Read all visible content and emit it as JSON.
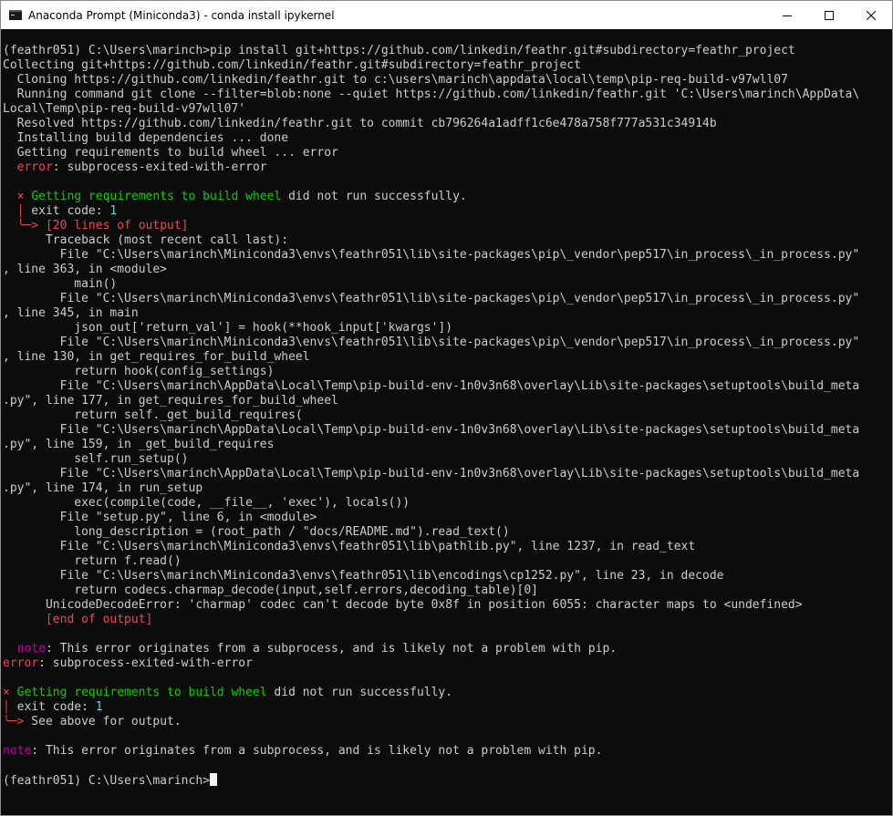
{
  "window": {
    "title": "Anaconda Prompt (Miniconda3) - conda  install ipykernel",
    "icon": "terminal-icon"
  },
  "colors": {
    "background": "#0c0c0c",
    "text": "#cccccc",
    "error_red": "#e74856",
    "success_green": "#16c60c",
    "note_magenta": "#b4009e",
    "number_cyan": "#61d6d6"
  },
  "console": {
    "lines": [
      [
        {
          "t": "(feathr051) C:\\Users\\marinch>pip install git+https://github.com/linkedin/feathr.git#subdirectory=feathr_project"
        }
      ],
      [
        {
          "t": "Collecting git+https://github.com/linkedin/feathr.git#subdirectory=feathr_project"
        }
      ],
      [
        {
          "t": "  Cloning https://github.com/linkedin/feathr.git to c:\\users\\marinch\\appdata\\local\\temp\\pip-req-build-v97wll07"
        }
      ],
      [
        {
          "t": "  Running command git clone --filter=blob:none --quiet https://github.com/linkedin/feathr.git 'C:\\Users\\marinch\\AppData\\"
        }
      ],
      [
        {
          "t": "Local\\Temp\\pip-req-build-v97wll07'"
        }
      ],
      [
        {
          "t": "  Resolved https://github.com/linkedin/feathr.git to commit cb796264a1adff1c6e478a758f777a531c34914b"
        }
      ],
      [
        {
          "t": "  Installing build dependencies ... done"
        }
      ],
      [
        {
          "t": "  Getting requirements to build wheel ... error"
        }
      ],
      [
        {
          "t": "  "
        },
        {
          "t": "error",
          "c": "red"
        },
        {
          "t": ": subprocess-exited-with-error"
        }
      ],
      [
        {
          "t": ""
        }
      ],
      [
        {
          "t": "  "
        },
        {
          "t": "×",
          "c": "red"
        },
        {
          "t": " "
        },
        {
          "t": "Getting requirements to build wheel",
          "c": "green"
        },
        {
          "t": " did not run successfully."
        }
      ],
      [
        {
          "t": "  "
        },
        {
          "t": "│",
          "c": "red"
        },
        {
          "t": " exit code: "
        },
        {
          "t": "1",
          "c": "cyan"
        }
      ],
      [
        {
          "t": "  "
        },
        {
          "t": "╰─> [20 lines of output]",
          "c": "red"
        }
      ],
      [
        {
          "t": "      Traceback (most recent call last):"
        }
      ],
      [
        {
          "t": "        File \"C:\\Users\\marinch\\Miniconda3\\envs\\feathr051\\lib\\site-packages\\pip\\_vendor\\pep517\\in_process\\_in_process.py\""
        }
      ],
      [
        {
          "t": ", line 363, in <module>"
        }
      ],
      [
        {
          "t": "          main()"
        }
      ],
      [
        {
          "t": "        File \"C:\\Users\\marinch\\Miniconda3\\envs\\feathr051\\lib\\site-packages\\pip\\_vendor\\pep517\\in_process\\_in_process.py\""
        }
      ],
      [
        {
          "t": ", line 345, in main"
        }
      ],
      [
        {
          "t": "          json_out['return_val'] = hook(**hook_input['kwargs'])"
        }
      ],
      [
        {
          "t": "        File \"C:\\Users\\marinch\\Miniconda3\\envs\\feathr051\\lib\\site-packages\\pip\\_vendor\\pep517\\in_process\\_in_process.py\""
        }
      ],
      [
        {
          "t": ", line 130, in get_requires_for_build_wheel"
        }
      ],
      [
        {
          "t": "          return hook(config_settings)"
        }
      ],
      [
        {
          "t": "        File \"C:\\Users\\marinch\\AppData\\Local\\Temp\\pip-build-env-1n0v3n68\\overlay\\Lib\\site-packages\\setuptools\\build_meta"
        }
      ],
      [
        {
          "t": ".py\", line 177, in get_requires_for_build_wheel"
        }
      ],
      [
        {
          "t": "          return self._get_build_requires("
        }
      ],
      [
        {
          "t": "        File \"C:\\Users\\marinch\\AppData\\Local\\Temp\\pip-build-env-1n0v3n68\\overlay\\Lib\\site-packages\\setuptools\\build_meta"
        }
      ],
      [
        {
          "t": ".py\", line 159, in _get_build_requires"
        }
      ],
      [
        {
          "t": "          self.run_setup()"
        }
      ],
      [
        {
          "t": "        File \"C:\\Users\\marinch\\AppData\\Local\\Temp\\pip-build-env-1n0v3n68\\overlay\\Lib\\site-packages\\setuptools\\build_meta"
        }
      ],
      [
        {
          "t": ".py\", line 174, in run_setup"
        }
      ],
      [
        {
          "t": "          exec(compile(code, __file__, 'exec'), locals())"
        }
      ],
      [
        {
          "t": "        File \"setup.py\", line 6, in <module>"
        }
      ],
      [
        {
          "t": "          long_description = (root_path / \"docs/README.md\").read_text()"
        }
      ],
      [
        {
          "t": "        File \"C:\\Users\\marinch\\Miniconda3\\envs\\feathr051\\lib\\pathlib.py\", line 1237, in read_text"
        }
      ],
      [
        {
          "t": "          return f.read()"
        }
      ],
      [
        {
          "t": "        File \"C:\\Users\\marinch\\Miniconda3\\envs\\feathr051\\lib\\encodings\\cp1252.py\", line 23, in decode"
        }
      ],
      [
        {
          "t": "          return codecs.charmap_decode(input,self.errors,decoding_table)[0]"
        }
      ],
      [
        {
          "t": "      UnicodeDecodeError: 'charmap' codec can't decode byte 0x8f in position 6055: character maps to <undefined>"
        }
      ],
      [
        {
          "t": "      "
        },
        {
          "t": "[end of output]",
          "c": "red"
        }
      ],
      [
        {
          "t": ""
        }
      ],
      [
        {
          "t": "  "
        },
        {
          "t": "note",
          "c": "magenta"
        },
        {
          "t": ": This error originates from a subprocess, and is likely not a problem with pip."
        }
      ],
      [
        {
          "t": "error",
          "c": "red"
        },
        {
          "t": ": subprocess-exited-with-error"
        }
      ],
      [
        {
          "t": ""
        }
      ],
      [
        {
          "t": "×",
          "c": "red"
        },
        {
          "t": " "
        },
        {
          "t": "Getting requirements to build wheel",
          "c": "green"
        },
        {
          "t": " did not run successfully."
        }
      ],
      [
        {
          "t": "│",
          "c": "red"
        },
        {
          "t": " exit code: "
        },
        {
          "t": "1",
          "c": "cyan"
        }
      ],
      [
        {
          "t": "╰─>",
          "c": "red"
        },
        {
          "t": " See above for output."
        }
      ],
      [
        {
          "t": ""
        }
      ],
      [
        {
          "t": "note",
          "c": "magenta"
        },
        {
          "t": ": This error originates from a subprocess, and is likely not a problem with pip."
        }
      ],
      [
        {
          "t": ""
        }
      ],
      [
        {
          "t": "(feathr051) C:\\Users\\marinch>"
        }
      ]
    ]
  }
}
